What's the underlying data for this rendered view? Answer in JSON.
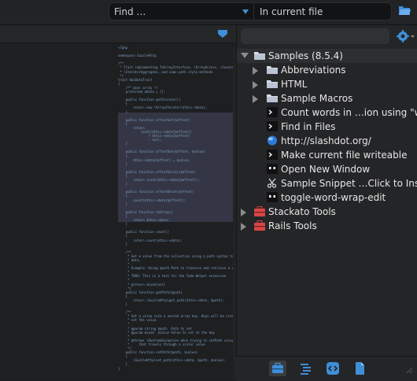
{
  "search": {
    "find_placeholder": "Find …",
    "scope": "In current file"
  },
  "tree": {
    "root": "Samples (8.5.4)",
    "items": [
      "Abbreviations",
      "HTML",
      "Sample Macros",
      "Count words in …ion using \"wc\"",
      "Find in Files",
      "http://slashdot.org/",
      "Make current file writeable",
      "Open New Window",
      "Sample Snippet …Click to Insert",
      "toggle-word-wrap-edit"
    ],
    "toolboxes": [
      "Stackato Tools",
      "Rails Tools"
    ]
  },
  "colors": {
    "accent": "#3f8fd8",
    "selection": "#3d3f52",
    "background": "#242527"
  },
  "icons": [
    "folder-open-icon",
    "gear-icon",
    "folder-icon",
    "command-icon",
    "globe-icon",
    "scissors-icon",
    "toolbox-icon"
  ]
}
